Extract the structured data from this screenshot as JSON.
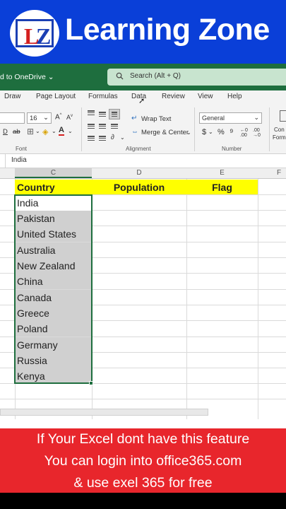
{
  "banner": {
    "title": "Learning Zone",
    "logo_letters": "LZ"
  },
  "titlebar": {
    "save_label": "d to OneDrive",
    "search_placeholder": "Search (Alt + Q)"
  },
  "tabs": [
    "Draw",
    "Page Layout",
    "Formulas",
    "Data",
    "Review",
    "View",
    "Help"
  ],
  "ribbon": {
    "font_size": "16",
    "font_group": "Font",
    "alignment_group": "Alignment",
    "number_group": "Number",
    "wrap_text": "Wrap Text",
    "merge_center": "Merge & Center",
    "number_format": "General",
    "cond_label_1": "Con",
    "cond_label_2": "Form"
  },
  "formula_bar": {
    "value": "India"
  },
  "grid": {
    "columns": [
      "C",
      "D",
      "E",
      "F"
    ],
    "headers": [
      "Country",
      "Population",
      "Flag"
    ],
    "countries": [
      "India",
      "Pakistan",
      "United States",
      "Australia",
      "New Zealand",
      "China",
      "Canada",
      "Greece",
      "Poland",
      "Germany",
      "Russia",
      "Kenya"
    ]
  },
  "caption": {
    "line1": "If Your Excel dont have this feature",
    "line2": "You can login into office365.com",
    "line3": "& use exel 365 for free"
  },
  "colors": {
    "excel_green": "#1e6e3e",
    "banner_blue": "#0a3fd8",
    "caption_red": "#e8262c",
    "header_yellow": "#ffff00"
  }
}
